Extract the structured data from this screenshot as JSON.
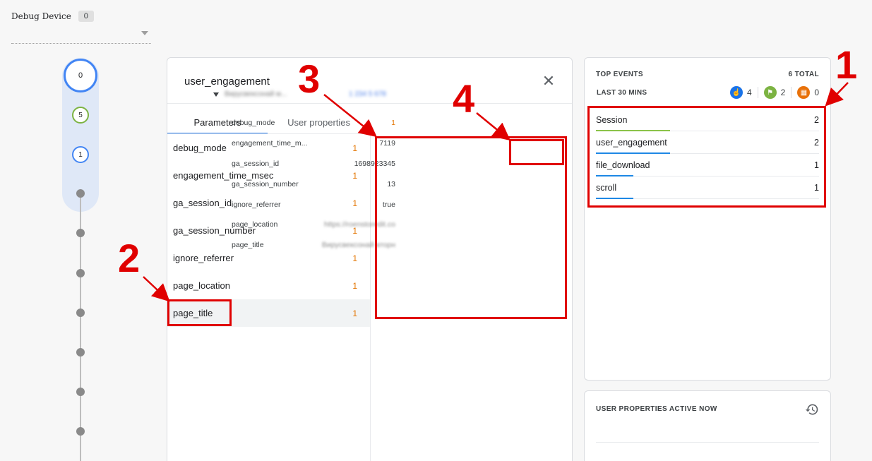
{
  "debug_device": {
    "label": "Debug Device",
    "count": "0"
  },
  "timeline": {
    "top_count": "0",
    "bubbles": [
      {
        "value": "5",
        "color": "#7cb342"
      },
      {
        "value": "1",
        "color": "#4285f4"
      }
    ]
  },
  "detail": {
    "title": "user_engagement",
    "tabs": [
      "Parameters",
      "User properties"
    ],
    "params": [
      {
        "name": "debug_mode",
        "count": "1"
      },
      {
        "name": "engagement_time_msec",
        "count": "1"
      },
      {
        "name": "ga_session_id",
        "count": "1"
      },
      {
        "name": "ga_session_number",
        "count": "1"
      },
      {
        "name": "ignore_referrer",
        "count": "1"
      },
      {
        "name": "page_location",
        "count": "1"
      },
      {
        "name": "page_title",
        "count": "1"
      }
    ],
    "values": [
      {
        "name": "debug_mode",
        "value": "1"
      },
      {
        "name": "engagement_time_m...",
        "value": "7119"
      },
      {
        "name": "ga_session_id",
        "value": "1698923345"
      },
      {
        "name": "ga_session_number",
        "value": "13"
      },
      {
        "name": "ignore_referrer",
        "value": "true"
      },
      {
        "name": "page_location",
        "value": "https://roenstoredit.co"
      },
      {
        "name": "page_title",
        "value": "Вирусвексонай вторн"
      }
    ]
  },
  "top_events": {
    "title": "TOP EVENTS",
    "total": "6 TOTAL",
    "subtitle": "LAST 30 MINS",
    "stats": [
      {
        "icon": "touch-icon",
        "value": "4",
        "color": "#1a73e8"
      },
      {
        "icon": "flag-icon",
        "value": "2",
        "color": "#7cb342"
      },
      {
        "icon": "gift-icon",
        "value": "0",
        "color": "#e8710a"
      }
    ],
    "events": [
      {
        "name": "Session",
        "count": "2",
        "color": "#8bc34a"
      },
      {
        "name": "user_engagement",
        "count": "2",
        "color": "#1e88e5"
      },
      {
        "name": "file_download",
        "count": "1",
        "color": "#1e88e5"
      },
      {
        "name": "scroll",
        "count": "1",
        "color": "#1e88e5"
      }
    ]
  },
  "user_properties": {
    "title": "USER PROPERTIES ACTIVE NOW"
  },
  "annotations": [
    "1",
    "2",
    "3",
    "4"
  ]
}
